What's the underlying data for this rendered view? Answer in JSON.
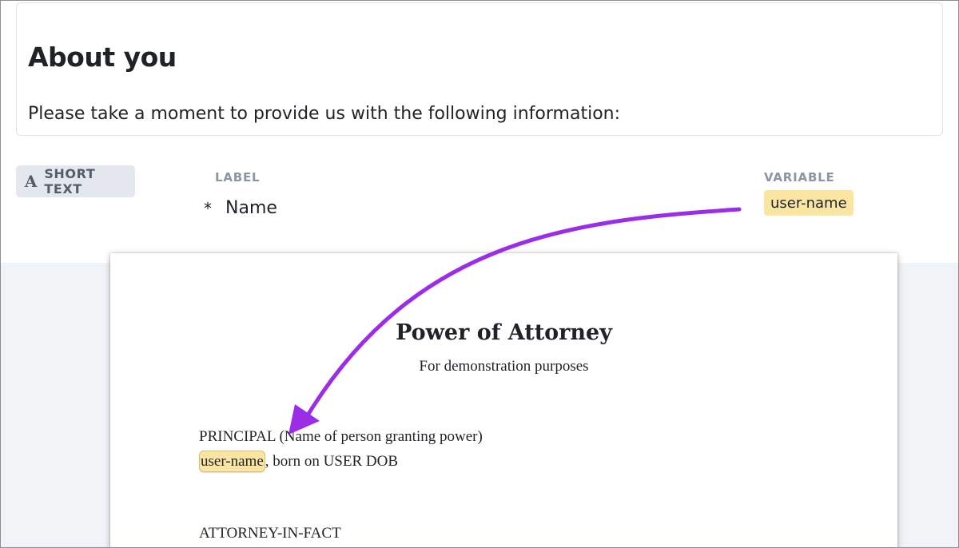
{
  "section": {
    "title": "About you",
    "description": "Please take a moment to provide us with the following information:"
  },
  "field": {
    "type_icon": "A",
    "type_icon_name": "text-type-icon",
    "type_label": "SHORT TEXT",
    "label_header": "LABEL",
    "variable_header": "VARIABLE",
    "required_marker": "*",
    "label": "Name",
    "variable": "user-name"
  },
  "document": {
    "title": "Power of Attorney",
    "subtitle": "For demonstration purposes",
    "principal_heading": "PRINCIPAL (Name of person granting power)",
    "principal_variable": "user-name",
    "principal_suffix": ", born on USER DOB",
    "attorney_heading": "ATTORNEY-IN-FACT"
  },
  "colors": {
    "variable_highlight": "#fbe5a3",
    "arrow": "#9b2de6",
    "badge_bg": "#e4e8ee",
    "header_gray": "#8b95a3"
  }
}
